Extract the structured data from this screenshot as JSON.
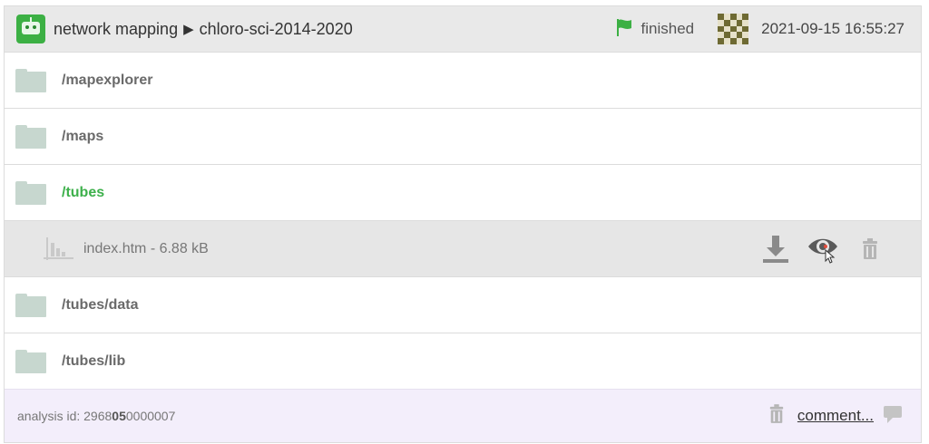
{
  "header": {
    "app_icon": "robot-icon",
    "breadcrumb_parent": "network mapping",
    "breadcrumb_separator": "▶",
    "breadcrumb_current": "chloro-sci-2014-2020",
    "status_icon": "flag-icon",
    "status_text": "finished",
    "status_color": "#3cb044",
    "user_avatar": "identicon",
    "timestamp": "2021-09-15 16:55:27"
  },
  "rows": [
    {
      "label": "/mapexplorer",
      "icon": "folder-icon",
      "active": false
    },
    {
      "label": "/maps",
      "icon": "folder-icon",
      "active": false
    },
    {
      "label": "/tubes",
      "icon": "folder-icon",
      "active": true
    },
    {
      "label": "index.htm - 6.88 kB",
      "icon": "chart-file-icon",
      "type": "file"
    },
    {
      "label": "/tubes/data",
      "icon": "folder-icon",
      "active": false
    },
    {
      "label": "/tubes/lib",
      "icon": "folder-icon",
      "active": false
    }
  ],
  "file_actions": {
    "download_icon": "download-icon",
    "view_icon": "eye-icon",
    "delete_icon": "trash-icon"
  },
  "footer": {
    "analysis_prefix": "analysis id: 2968",
    "analysis_bold": "05",
    "analysis_suffix": "0000007",
    "delete_icon": "trash-icon",
    "comment_label": "comment...",
    "comment_icon": "speech-bubble-icon"
  },
  "colors": {
    "accent": "#3db04b",
    "header_bg": "#e9e9e9",
    "footer_bg": "#f3eefb",
    "folder": "#c7d7cf"
  }
}
